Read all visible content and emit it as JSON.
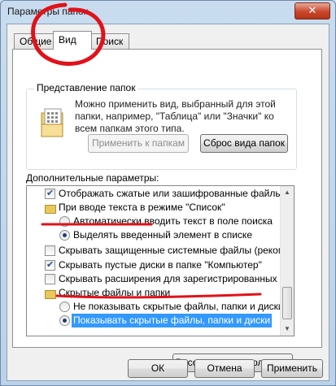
{
  "window": {
    "title": "Параметры папок",
    "close_glyph": "✕"
  },
  "tabs": [
    {
      "label": "Общие"
    },
    {
      "label": "Вид"
    },
    {
      "label": "Поиск"
    }
  ],
  "folder_view": {
    "group_title": "Представление папок",
    "description": "Можно применить вид, выбранный для этой папки, например, \"Таблица\" или \"Значки\" ко всем папкам этого типа.",
    "apply_button": "Применить к папкам",
    "reset_button": "Сброс вида папок"
  },
  "advanced": {
    "label": "Дополнительные параметры:",
    "items": [
      {
        "kind": "checkbox",
        "checked": true,
        "label": "Отображать сжатые или зашифрованные файлы NTFS"
      },
      {
        "kind": "folder",
        "label": "При вводе текста в режиме \"Список\""
      },
      {
        "kind": "radio",
        "checked": false,
        "label": "Автоматически вводить текст в поле поиска"
      },
      {
        "kind": "radio",
        "checked": true,
        "label": "Выделять введенный элемент в списке"
      },
      {
        "kind": "checkbox",
        "checked": false,
        "label": "Скрывать защищенные системные файлы (рекомендуется)"
      },
      {
        "kind": "checkbox",
        "checked": true,
        "label": "Скрывать пустые диски в папке \"Компьютер\""
      },
      {
        "kind": "checkbox",
        "checked": false,
        "label": "Скрывать расширения для зарегистрированных типов файлов"
      },
      {
        "kind": "folder",
        "label": "Скрытые файлы и папки"
      },
      {
        "kind": "radio",
        "checked": false,
        "label": "Не показывать скрытые файлы, папки и диски"
      },
      {
        "kind": "radio",
        "checked": true,
        "selected": true,
        "label": "Показывать скрытые файлы, папки и диски"
      }
    ]
  },
  "buttons": {
    "restore": "Восстановить умолчания",
    "ok": "ОК",
    "cancel": "Отмена",
    "apply": "Применить"
  },
  "annotation_color": "#e0121a"
}
